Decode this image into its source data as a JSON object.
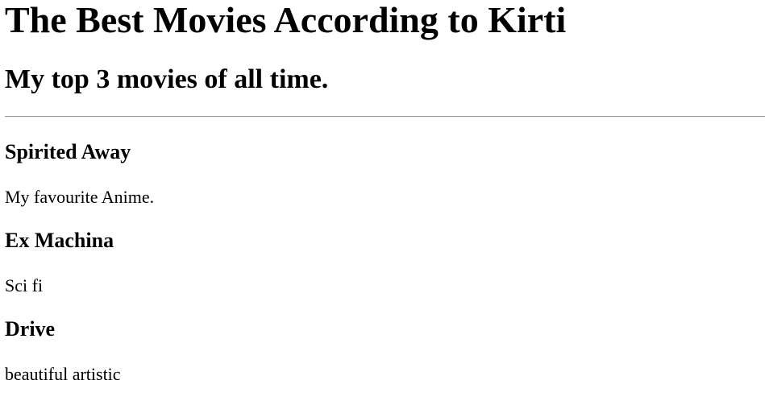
{
  "page": {
    "title": "The Best Movies According to Kirti",
    "subtitle": "My top 3 movies of all time."
  },
  "movies": [
    {
      "title": "Spirited Away",
      "description": "My favourite Anime."
    },
    {
      "title": "Ex Machina",
      "description": "Sci fi"
    },
    {
      "title": "Drive",
      "description": "beautiful artistic"
    }
  ]
}
